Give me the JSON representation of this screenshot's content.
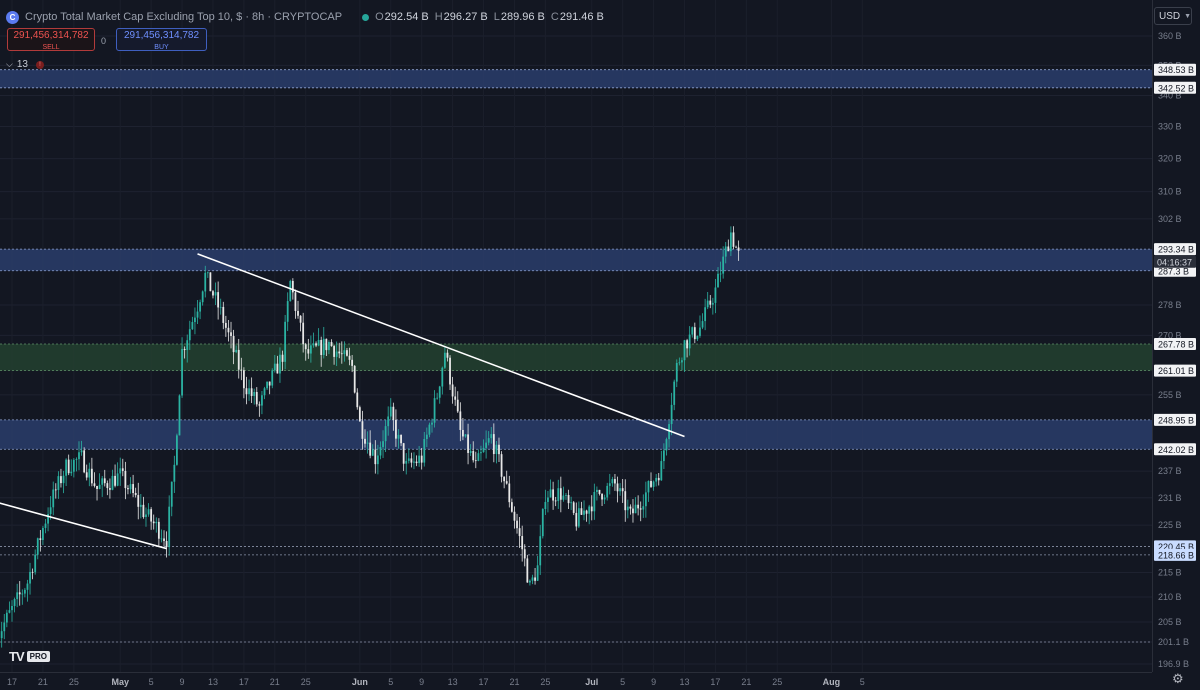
{
  "header": {
    "title": "Crypto Total Market Cap Excluding Top 10, $ · 8h · CRYPTOCAP",
    "ohlc": [
      {
        "key": "O",
        "value": "292.54 B"
      },
      {
        "key": "H",
        "value": "296.27 B"
      },
      {
        "key": "L",
        "value": "289.96 B"
      },
      {
        "key": "C",
        "value": "291.46 B"
      }
    ]
  },
  "trade": {
    "sell_price": "291,456,314,782",
    "sell_label": "SELL",
    "spread": "0",
    "buy_price": "291,456,314,782",
    "buy_label": "BUY"
  },
  "indicators": {
    "count": "13",
    "alert": "!"
  },
  "currency": "USD",
  "branding": {
    "logo": "TV",
    "plan": "PRO"
  },
  "icons": {
    "settings": "gear-icon",
    "symbol": "crypto-logo-icon",
    "collapse": "chevron-down-icon"
  },
  "colors": {
    "background": "#131722",
    "up": "#2bb3a3",
    "down": "#e8e8e8",
    "resistance_zone": "#2a3d6b",
    "support_zone": "#23412f",
    "trendline": "#ffffff"
  },
  "chart_data": {
    "type": "candlestick",
    "symbol": "CRYPTOCAP",
    "interval": "8h",
    "y_scale": "log",
    "ylim": [
      195,
      362
    ],
    "y_ticks": [
      "360 B",
      "350 B",
      "340 B",
      "330 B",
      "320 B",
      "310 B",
      "302 B",
      "278 B",
      "270 B",
      "255 B",
      "237 B",
      "231 B",
      "225 B",
      "215 B",
      "210 B",
      "205 B",
      "201.1 B",
      "196.9 B"
    ],
    "x_ticks": [
      {
        "label": "17",
        "date": "2023-04-17"
      },
      {
        "label": "21",
        "date": "2023-04-21"
      },
      {
        "label": "25",
        "date": "2023-04-25"
      },
      {
        "label": "May",
        "date": "2023-05-01"
      },
      {
        "label": "5",
        "date": "2023-05-05"
      },
      {
        "label": "9",
        "date": "2023-05-09"
      },
      {
        "label": "13",
        "date": "2023-05-13"
      },
      {
        "label": "17",
        "date": "2023-05-17"
      },
      {
        "label": "21",
        "date": "2023-05-21"
      },
      {
        "label": "25",
        "date": "2023-05-25"
      },
      {
        "label": "Jun",
        "date": "2023-06-01"
      },
      {
        "label": "5",
        "date": "2023-06-05"
      },
      {
        "label": "9",
        "date": "2023-06-09"
      },
      {
        "label": "13",
        "date": "2023-06-13"
      },
      {
        "label": "17",
        "date": "2023-06-17"
      },
      {
        "label": "21",
        "date": "2023-06-21"
      },
      {
        "label": "25",
        "date": "2023-06-25"
      },
      {
        "label": "Jul",
        "date": "2023-07-01"
      },
      {
        "label": "5",
        "date": "2023-07-05"
      },
      {
        "label": "9",
        "date": "2023-07-09"
      },
      {
        "label": "13",
        "date": "2023-07-13"
      },
      {
        "label": "17",
        "date": "2023-07-17"
      },
      {
        "label": "21",
        "date": "2023-07-21"
      },
      {
        "label": "25",
        "date": "2023-07-25"
      },
      {
        "label": "Aug",
        "date": "2023-08-01"
      },
      {
        "label": "5",
        "date": "2023-08-05"
      }
    ],
    "zones": [
      {
        "type": "resistance",
        "from": 342.52,
        "to": 348.53,
        "labels": [
          "348.53 B",
          "342.52 B"
        ]
      },
      {
        "type": "resistance",
        "from": 287.3,
        "to": 293.34,
        "labels": [
          "293.34 B",
          "287.3 B"
        ]
      },
      {
        "type": "support",
        "from": 261.01,
        "to": 267.78,
        "labels": [
          "267.78 B",
          "261.01 B"
        ]
      },
      {
        "type": "resistance",
        "from": 242.02,
        "to": 248.95,
        "labels": [
          "248.95 B",
          "242.02 B"
        ]
      }
    ],
    "horizontal_lines": [
      {
        "value": 220.45,
        "label": "220.45 B",
        "highlight": true
      },
      {
        "value": 218.66,
        "label": "218.66 B",
        "highlight": true
      },
      {
        "value": 201.1,
        "label": "",
        "highlight": false
      }
    ],
    "trendlines": [
      {
        "from": {
          "date": "2023-04-15",
          "value": 230
        },
        "to": {
          "date": "2023-05-07",
          "value": 220
        }
      },
      {
        "from": {
          "date": "2023-05-11",
          "value": 292
        },
        "to": {
          "date": "2023-07-13",
          "value": 245
        }
      }
    ],
    "last_price": {
      "value": 291.46,
      "countdown": "04:16:37"
    },
    "series": [
      {
        "date": "2023-04-15",
        "close": 202
      },
      {
        "date": "2023-04-19",
        "close": 213
      },
      {
        "date": "2023-04-22",
        "close": 230
      },
      {
        "date": "2023-04-24",
        "close": 238
      },
      {
        "date": "2023-04-26",
        "close": 240
      },
      {
        "date": "2023-04-28",
        "close": 233
      },
      {
        "date": "2023-05-01",
        "close": 236
      },
      {
        "date": "2023-05-04",
        "close": 228
      },
      {
        "date": "2023-05-07",
        "close": 222
      },
      {
        "date": "2023-05-08",
        "close": 238
      },
      {
        "date": "2023-05-09",
        "close": 266
      },
      {
        "date": "2023-05-11",
        "close": 278
      },
      {
        "date": "2023-05-12",
        "close": 286
      },
      {
        "date": "2023-05-14",
        "close": 276
      },
      {
        "date": "2023-05-17",
        "close": 258
      },
      {
        "date": "2023-05-19",
        "close": 252
      },
      {
        "date": "2023-05-22",
        "close": 265
      },
      {
        "date": "2023-05-23",
        "close": 284
      },
      {
        "date": "2023-05-25",
        "close": 265
      },
      {
        "date": "2023-05-28",
        "close": 268
      },
      {
        "date": "2023-05-31",
        "close": 262
      },
      {
        "date": "2023-06-01",
        "close": 248
      },
      {
        "date": "2023-06-03",
        "close": 240
      },
      {
        "date": "2023-06-05",
        "close": 250
      },
      {
        "date": "2023-06-07",
        "close": 238
      },
      {
        "date": "2023-06-09",
        "close": 240
      },
      {
        "date": "2023-06-11",
        "close": 255
      },
      {
        "date": "2023-06-12",
        "close": 266
      },
      {
        "date": "2023-06-14",
        "close": 246
      },
      {
        "date": "2023-06-16",
        "close": 238
      },
      {
        "date": "2023-06-18",
        "close": 245
      },
      {
        "date": "2023-06-20",
        "close": 233
      },
      {
        "date": "2023-06-22",
        "close": 220
      },
      {
        "date": "2023-06-23",
        "close": 212
      },
      {
        "date": "2023-06-24",
        "close": 216
      },
      {
        "date": "2023-06-25",
        "close": 232
      },
      {
        "date": "2023-06-27",
        "close": 232
      },
      {
        "date": "2023-06-29",
        "close": 226
      },
      {
        "date": "2023-07-02",
        "close": 232
      },
      {
        "date": "2023-07-04",
        "close": 234
      },
      {
        "date": "2023-07-06",
        "close": 227
      },
      {
        "date": "2023-07-08",
        "close": 232
      },
      {
        "date": "2023-07-10",
        "close": 238
      },
      {
        "date": "2023-07-11",
        "close": 250
      },
      {
        "date": "2023-07-12",
        "close": 262
      },
      {
        "date": "2023-07-13",
        "close": 268
      },
      {
        "date": "2023-07-15",
        "close": 272
      },
      {
        "date": "2023-07-17",
        "close": 282
      },
      {
        "date": "2023-07-19",
        "close": 298
      },
      {
        "date": "2023-07-20",
        "close": 291.46
      }
    ]
  }
}
